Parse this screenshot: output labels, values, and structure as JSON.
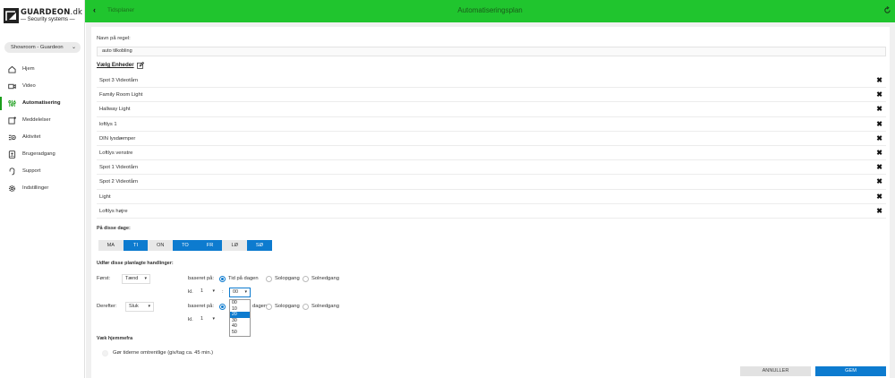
{
  "brand": {
    "name": "GUARDEON",
    "domain": ".dk",
    "tagline": "— Security systems —"
  },
  "location": {
    "label": "Showroom - Guardeon"
  },
  "nav": [
    {
      "label": "Hjem",
      "icon": "home-icon"
    },
    {
      "label": "Video",
      "icon": "video-icon"
    },
    {
      "label": "Automatisering",
      "icon": "automation-icon",
      "active": true
    },
    {
      "label": "Meddelelser",
      "icon": "message-icon"
    },
    {
      "label": "Aktivitet",
      "icon": "activity-icon"
    },
    {
      "label": "Brugeradgang",
      "icon": "user-access-icon"
    },
    {
      "label": "Support",
      "icon": "support-icon"
    },
    {
      "label": "Indstillinger",
      "icon": "settings-icon"
    }
  ],
  "header": {
    "back_label": "Tidsplaner",
    "title": "Automatiseringsplan",
    "accent": "#20c52e"
  },
  "form": {
    "rule_name_label": "Navn på regel:",
    "rule_name_value": "auto tilkobling",
    "devices_heading": "Vælg Enheder",
    "devices": [
      "Spot 3 Videotårn",
      "Family Room Light",
      "Hallway Light",
      "loftlys 1",
      "DIN lysdæmper",
      "Loftlys venstre",
      "Spot 1 Videotårn",
      "Spot 2 Videotårn",
      "Light",
      "Loftlys højre"
    ],
    "days_heading": "På disse dage:",
    "days": [
      {
        "label": "MA",
        "on": false
      },
      {
        "label": "TI",
        "on": true
      },
      {
        "label": "ON",
        "on": false
      },
      {
        "label": "TO",
        "on": true
      },
      {
        "label": "FR",
        "on": true
      },
      {
        "label": "LØ",
        "on": false
      },
      {
        "label": "SØ",
        "on": true
      }
    ],
    "actions_heading": "Udfør disse planlagte handlinger:",
    "first": {
      "label": "Først:",
      "action": "Tænd",
      "based_on": "baseret på:",
      "options": [
        "Tid på dagen",
        "Solopgang",
        "Solnedgang"
      ],
      "selected": 0,
      "time_prefix": "kl.",
      "hour": "1",
      "colon": ":",
      "minute": "00"
    },
    "then": {
      "label": "Derefter:",
      "action": "Sluk",
      "based_on": "baseret på:",
      "options": [
        "dagen",
        "Solopgang",
        "Solnedgang"
      ],
      "time_prefix": "kl.",
      "hour": "1"
    },
    "minute_options": [
      "00",
      "10",
      "20",
      "30",
      "40",
      "50"
    ],
    "minute_highlight": 2,
    "away_heading": "Væk hjemmefra",
    "away_option": "Gør tiderne omtrentlige (giv/tag ca. 45 min.)",
    "cancel_label": "ANNULLER",
    "save_label": "GEM",
    "primary_color": "#0d7bcf"
  }
}
